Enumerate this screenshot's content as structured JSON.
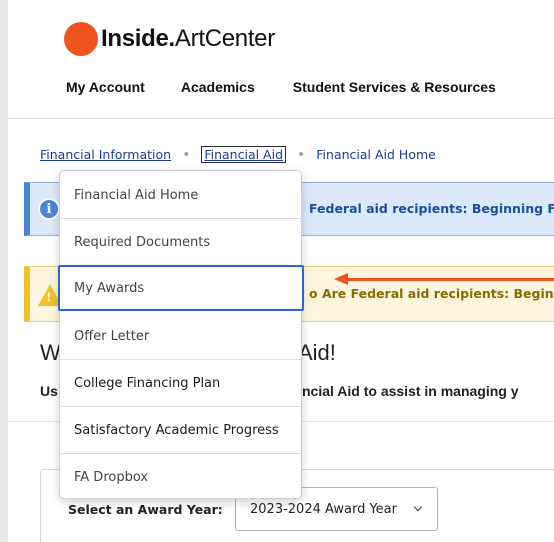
{
  "header": {
    "logo_inside": "Inside.",
    "logo_artcenter": "ArtCenter",
    "nav": [
      "My Account",
      "Academics",
      "Student Services & Resources"
    ]
  },
  "breadcrumb": {
    "items": [
      "Financial Information",
      "Financial Aid",
      "Financial Aid Home"
    ]
  },
  "banners": {
    "info_text": "Federal aid recipients: Beginning Fa",
    "warning_text": "o Are Federal aid recipients: Beginn"
  },
  "dropdown": {
    "items": [
      "Financial Aid Home",
      "Required Documents",
      "My Awards",
      "Offer Letter",
      "College Financing Plan",
      "Satisfactory Academic Progress",
      "FA Dropbox"
    ],
    "highlighted_index": 2
  },
  "welcome": {
    "title_start": "W",
    "title_end": "Aid!",
    "subtitle_start": "Us",
    "subtitle_end": "ncial Aid to assist in managing y"
  },
  "award_year": {
    "label": "Select an Award Year:",
    "selected": "2023-2024 Award Year"
  },
  "colors": {
    "brand_orange": "#f0531f",
    "link_blue": "#1a3d8f",
    "info_blue": "#4a86d8",
    "warning_yellow": "#f2c12e",
    "highlight_border": "#2f64d6"
  },
  "icons": {
    "info": "info-icon",
    "warning": "warning-icon",
    "select_chevron": "chevron-down-icon",
    "annotation_arrow": "arrow-left-icon"
  }
}
